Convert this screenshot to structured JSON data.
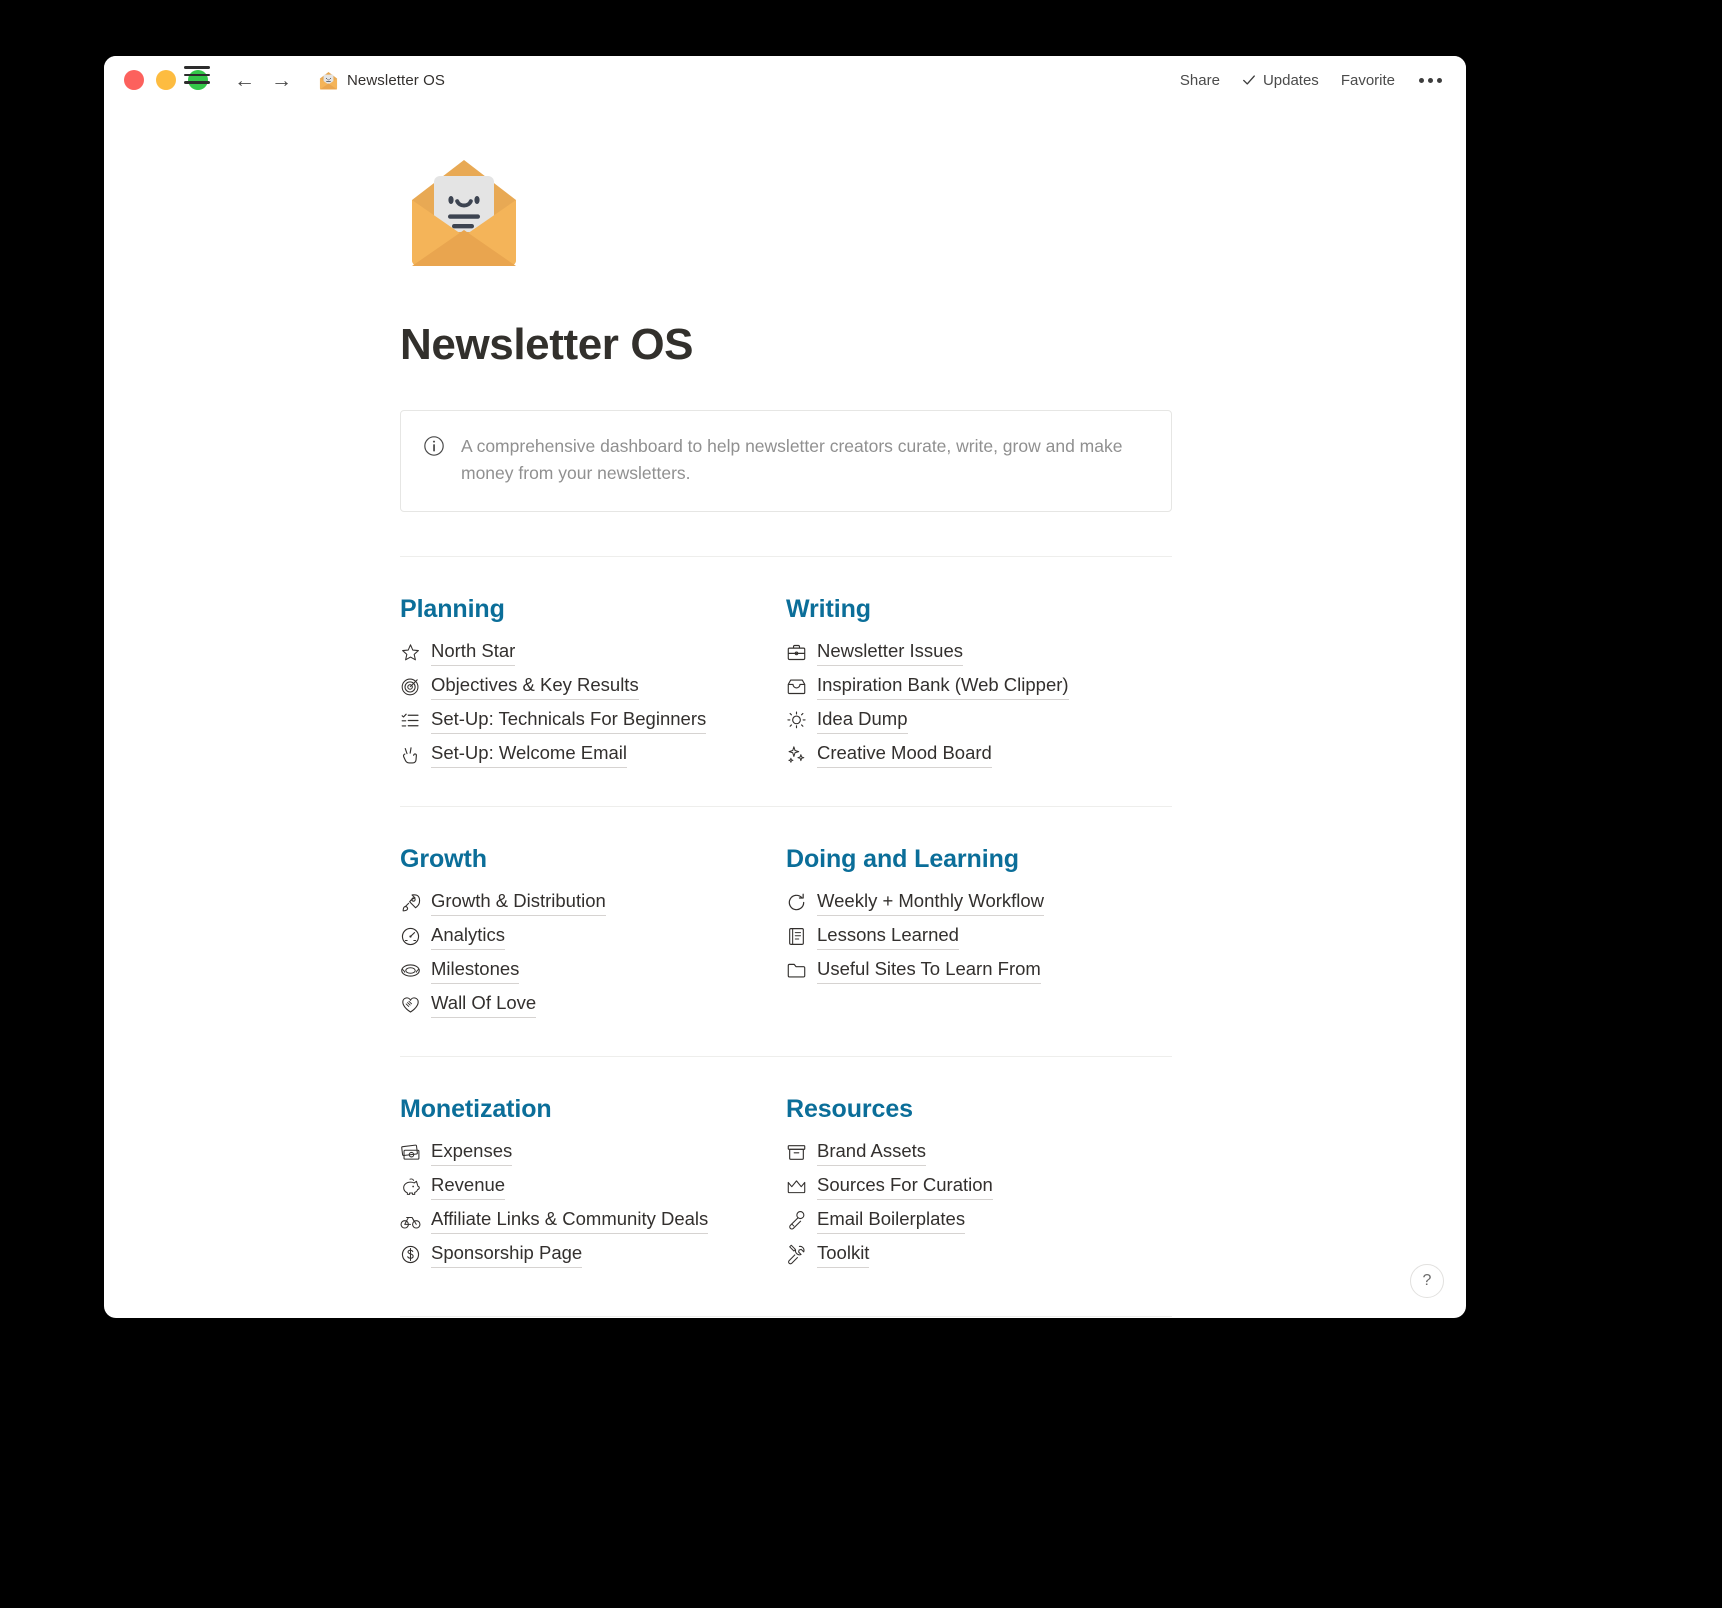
{
  "window": {
    "traffic_lights": [
      "close",
      "minimize",
      "zoom"
    ],
    "sidebar_toggle": "menu-icon",
    "back": "←",
    "forward": "→",
    "breadcrumb": "Newsletter OS",
    "breadcrumb_icon": "envelope-with-face-emoji",
    "share_label": "Share",
    "updates_label": "Updates",
    "favorite_label": "Favorite",
    "more_label": "•••"
  },
  "page": {
    "icon": "envelope-with-face-emoji",
    "title": "Newsletter OS",
    "callout": {
      "icon": "info-icon",
      "text": "A comprehensive dashboard to help newsletter creators curate, write, grow and make money from your newsletters."
    },
    "help_label": "?",
    "accent_color": "#0b6e99",
    "text_color": "#33302e",
    "muted_color": "#909090"
  },
  "sections": [
    {
      "title": "Planning",
      "items": [
        {
          "icon": "star-icon",
          "label": "North Star"
        },
        {
          "icon": "target-icon",
          "label": "Objectives & Key Results"
        },
        {
          "icon": "checklist-icon",
          "label": "Set-Up: Technicals For Beginners"
        },
        {
          "icon": "victory-hand-icon",
          "label": "Set-Up: Welcome Email"
        }
      ]
    },
    {
      "title": "Writing",
      "items": [
        {
          "icon": "briefcase-icon",
          "label": "Newsletter Issues"
        },
        {
          "icon": "inbox-tray-icon",
          "label": "Inspiration Bank (Web Clipper)"
        },
        {
          "icon": "lightbulb-icon",
          "label": "Idea Dump"
        },
        {
          "icon": "sparkles-icon",
          "label": "Creative Mood Board"
        }
      ]
    },
    {
      "title": "Growth",
      "items": [
        {
          "icon": "rocket-icon",
          "label": "Growth & Distribution"
        },
        {
          "icon": "gauge-icon",
          "label": "Analytics"
        },
        {
          "icon": "stadium-icon",
          "label": "Milestones"
        },
        {
          "icon": "handshake-heart-icon",
          "label": "Wall Of Love"
        }
      ]
    },
    {
      "title": "Doing and Learning",
      "items": [
        {
          "icon": "refresh-icon",
          "label": "Weekly + Monthly Workflow"
        },
        {
          "icon": "book-icon",
          "label": "Lessons Learned"
        },
        {
          "icon": "folder-icon",
          "label": "Useful Sites To Learn From"
        }
      ]
    },
    {
      "title": "Monetization",
      "items": [
        {
          "icon": "money-banknotes-icon",
          "label": "Expenses"
        },
        {
          "icon": "piggy-bank-icon",
          "label": "Revenue"
        },
        {
          "icon": "bicycle-icon",
          "label": "Affiliate Links & Community Deals"
        },
        {
          "icon": "dollar-coin-icon",
          "label": "Sponsorship Page"
        }
      ]
    },
    {
      "title": "Resources",
      "items": [
        {
          "icon": "card-file-box-icon",
          "label": "Brand Assets"
        },
        {
          "icon": "crown-icon",
          "label": "Sources For Curation"
        },
        {
          "icon": "microphone-icon",
          "label": "Email Boilerplates"
        },
        {
          "icon": "tools-icon",
          "label": "Toolkit"
        }
      ]
    }
  ]
}
